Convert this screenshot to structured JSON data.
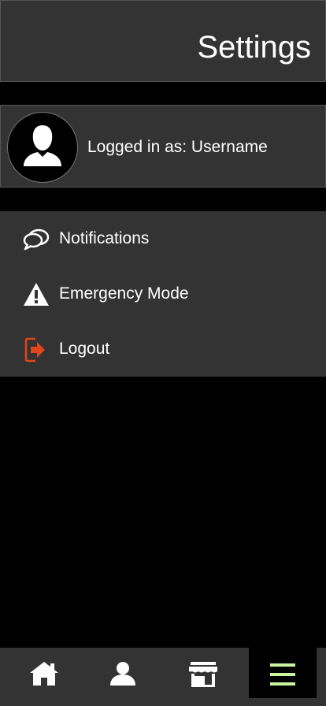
{
  "header": {
    "title": "Settings"
  },
  "profile": {
    "avatar_icon": "user-silhouette-icon",
    "login_text": "Logged in as: Username"
  },
  "menu": {
    "items": [
      {
        "label": "Notifications",
        "icon": "chat-bubbles-icon"
      },
      {
        "label": "Emergency Mode",
        "icon": "warning-icon"
      },
      {
        "label": "Logout",
        "icon": "logout-icon"
      }
    ]
  },
  "bottom_nav": {
    "items": [
      {
        "icon": "home-icon",
        "active": false
      },
      {
        "icon": "user-icon",
        "active": false
      },
      {
        "icon": "store-icon",
        "active": false
      },
      {
        "icon": "menu-icon",
        "active": true
      }
    ]
  },
  "colors": {
    "panel": "#333333",
    "background": "#000000",
    "accent_logout": "#e0461c",
    "accent_menu": "#c8f5a0"
  }
}
